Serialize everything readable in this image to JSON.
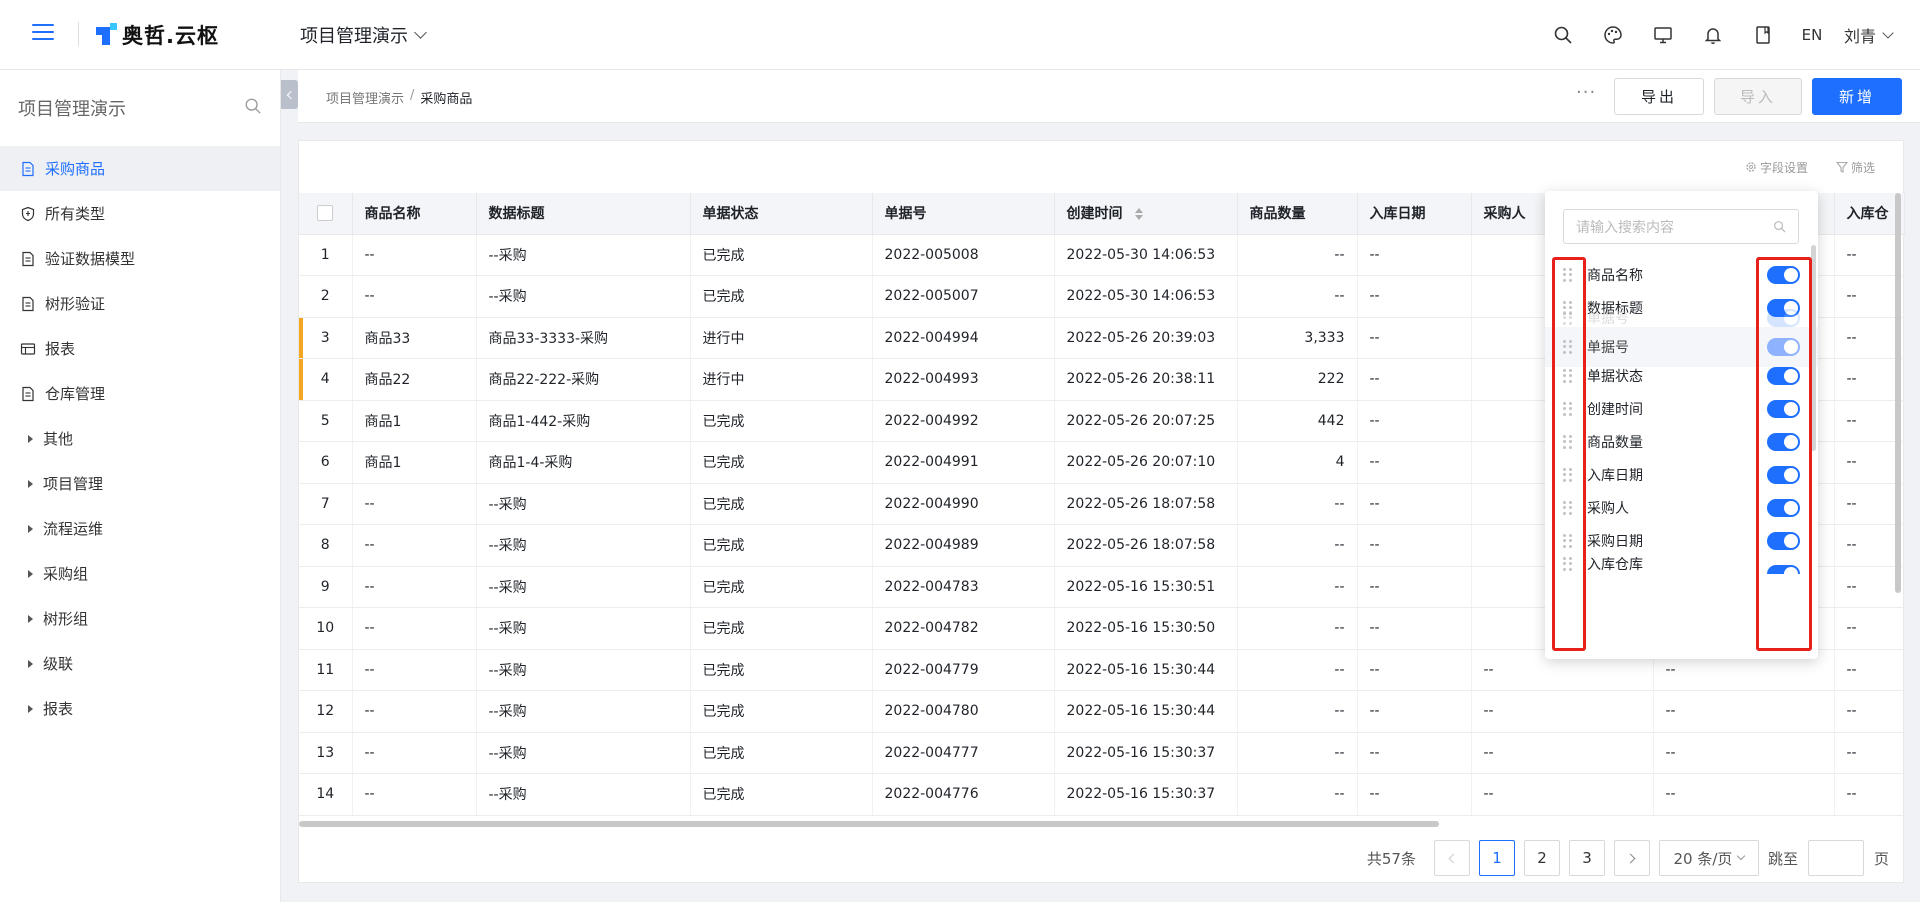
{
  "app": {
    "logo_text": "奥哲.云枢",
    "project_name": "项目管理演示",
    "language": "EN",
    "user_name": "刘青"
  },
  "sidebar": {
    "title": "项目管理演示",
    "items": [
      {
        "label": "采购商品",
        "icon": "document-icon",
        "active": true
      },
      {
        "label": "所有类型",
        "icon": "shield-icon"
      },
      {
        "label": "验证数据模型",
        "icon": "document-icon"
      },
      {
        "label": "树形验证",
        "icon": "document-icon"
      },
      {
        "label": "报表",
        "icon": "report-icon"
      },
      {
        "label": "仓库管理",
        "icon": "document-icon"
      }
    ],
    "groups": [
      "其他",
      "项目管理",
      "流程运维",
      "采购组",
      "树形组",
      "级联",
      "报表"
    ]
  },
  "breadcrumb": {
    "parent": "项目管理演示",
    "separator": "/",
    "current": "采购商品"
  },
  "toolbar": {
    "more": "···",
    "export_label": "导出",
    "import_label": "导入",
    "add_label": "新增"
  },
  "table_tools": {
    "field_settings": "字段设置",
    "filter": "筛选"
  },
  "table": {
    "columns": [
      "商品名称",
      "数据标题",
      "单据状态",
      "单据号",
      "创建时间",
      "商品数量",
      "入库日期",
      "采购人",
      "",
      "入库仓"
    ],
    "rows": [
      {
        "idx": "1",
        "name": "--",
        "title": "--采购",
        "status": "已完成",
        "no": "2022-005008",
        "created": "2022-05-30 14:06:53",
        "qty": "--",
        "in_date": "--",
        "buyer": "",
        "c8": "",
        "c9": "--"
      },
      {
        "idx": "2",
        "name": "--",
        "title": "--采购",
        "status": "已完成",
        "no": "2022-005007",
        "created": "2022-05-30 14:06:53",
        "qty": "--",
        "in_date": "--",
        "buyer": "",
        "c8": "",
        "c9": "--"
      },
      {
        "idx": "3",
        "name": "商品33",
        "title": "商品33-3333-采购",
        "status": "进行中",
        "no": "2022-004994",
        "created": "2022-05-26 20:39:03",
        "qty": "3,333",
        "in_date": "--",
        "buyer": "",
        "c8": "",
        "c9": "--",
        "marked": true
      },
      {
        "idx": "4",
        "name": "商品22",
        "title": "商品22-222-采购",
        "status": "进行中",
        "no": "2022-004993",
        "created": "2022-05-26 20:38:11",
        "qty": "222",
        "in_date": "--",
        "buyer": "",
        "c8": "",
        "c9": "--",
        "marked": true
      },
      {
        "idx": "5",
        "name": "商品1",
        "title": "商品1-442-采购",
        "status": "已完成",
        "no": "2022-004992",
        "created": "2022-05-26 20:07:25",
        "qty": "442",
        "in_date": "--",
        "buyer": "",
        "c8": "",
        "c9": "--"
      },
      {
        "idx": "6",
        "name": "商品1",
        "title": "商品1-4-采购",
        "status": "已完成",
        "no": "2022-004991",
        "created": "2022-05-26 20:07:10",
        "qty": "4",
        "in_date": "--",
        "buyer": "",
        "c8": "",
        "c9": "--"
      },
      {
        "idx": "7",
        "name": "--",
        "title": "--采购",
        "status": "已完成",
        "no": "2022-004990",
        "created": "2022-05-26 18:07:58",
        "qty": "--",
        "in_date": "--",
        "buyer": "",
        "c8": "",
        "c9": "--"
      },
      {
        "idx": "8",
        "name": "--",
        "title": "--采购",
        "status": "已完成",
        "no": "2022-004989",
        "created": "2022-05-26 18:07:58",
        "qty": "--",
        "in_date": "--",
        "buyer": "",
        "c8": "",
        "c9": "--"
      },
      {
        "idx": "9",
        "name": "--",
        "title": "--采购",
        "status": "已完成",
        "no": "2022-004783",
        "created": "2022-05-16 15:30:51",
        "qty": "--",
        "in_date": "--",
        "buyer": "",
        "c8": "",
        "c9": "--"
      },
      {
        "idx": "10",
        "name": "--",
        "title": "--采购",
        "status": "已完成",
        "no": "2022-004782",
        "created": "2022-05-16 15:30:50",
        "qty": "--",
        "in_date": "--",
        "buyer": "",
        "c8": "",
        "c9": "--"
      },
      {
        "idx": "11",
        "name": "--",
        "title": "--采购",
        "status": "已完成",
        "no": "2022-004779",
        "created": "2022-05-16 15:30:44",
        "qty": "--",
        "in_date": "--",
        "buyer": "--",
        "c8": "--",
        "c9": "--"
      },
      {
        "idx": "12",
        "name": "--",
        "title": "--采购",
        "status": "已完成",
        "no": "2022-004780",
        "created": "2022-05-16 15:30:44",
        "qty": "--",
        "in_date": "--",
        "buyer": "--",
        "c8": "--",
        "c9": "--"
      },
      {
        "idx": "13",
        "name": "--",
        "title": "--采购",
        "status": "已完成",
        "no": "2022-004777",
        "created": "2022-05-16 15:30:37",
        "qty": "--",
        "in_date": "--",
        "buyer": "--",
        "c8": "--",
        "c9": "--"
      },
      {
        "idx": "14",
        "name": "--",
        "title": "--采购",
        "status": "已完成",
        "no": "2022-004776",
        "created": "2022-05-16 15:30:37",
        "qty": "--",
        "in_date": "--",
        "buyer": "--",
        "c8": "--",
        "c9": "--"
      }
    ]
  },
  "pagination": {
    "total": "共57条",
    "pages": [
      "1",
      "2",
      "3"
    ],
    "current": "1",
    "page_size": "20 条/页",
    "jump_label": "跳至",
    "page_suffix": "页"
  },
  "column_settings": {
    "search_placeholder": "请输入搜索内容",
    "items": [
      {
        "label": "商品名称",
        "enabled": true
      },
      {
        "label": "数据标题",
        "enabled": true
      },
      {
        "label": "单据号",
        "enabled": true,
        "state": "ghost"
      },
      {
        "label": "单据号",
        "enabled": true,
        "state": "dragging"
      },
      {
        "label": "单据状态",
        "enabled": true
      },
      {
        "label": "创建时间",
        "enabled": true
      },
      {
        "label": "商品数量",
        "enabled": true
      },
      {
        "label": "入库日期",
        "enabled": true
      },
      {
        "label": "采购人",
        "enabled": true
      },
      {
        "label": "采购日期",
        "enabled": true
      },
      {
        "label": "入库仓库",
        "enabled": true
      }
    ]
  },
  "colors": {
    "accent": "#1f6fff",
    "highlight_box": "#e8201a",
    "row_marker": "#f5a623"
  }
}
